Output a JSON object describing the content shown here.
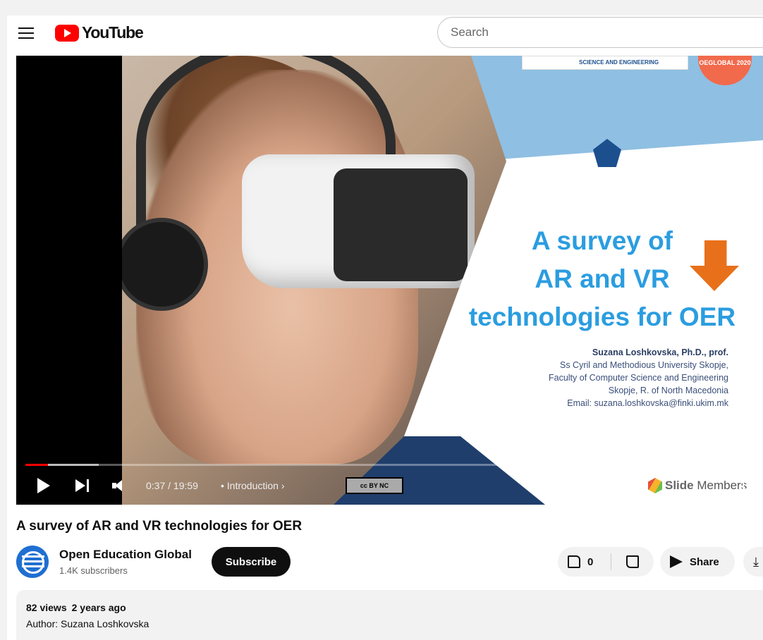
{
  "header": {
    "logo_text": "YouTube",
    "search_placeholder": "Search"
  },
  "player": {
    "time": "0:37 / 19:59",
    "chapter": "• Introduction ›",
    "progress_fraction": 0.031,
    "slide": {
      "title_lines": [
        "A survey of",
        "AR and VR",
        "technologies for OER"
      ],
      "logo_text": "SCIENCE AND ENGINEERING",
      "badge_text": "OEGLOBAL 2020",
      "author_name": "Suzana Loshkovska, Ph.D., prof.",
      "affiliation_1": "Ss Cyril and Methodious University Skopje,",
      "affiliation_2": "Faculty of Computer Science and Engineering",
      "affiliation_3": "Skopje, R. of North Macedonia",
      "email": "Email: suzana.loshkovska@finki.ukim.mk"
    },
    "cc_badge": "cc BY NC",
    "brand_bold": "Slide",
    "brand_rest": " Members"
  },
  "video": {
    "title": "A survey of AR and VR technologies for OER",
    "channel_name": "Open Education Global",
    "subscribers": "1.4K subscribers",
    "subscribe_label": "Subscribe",
    "likes": "0",
    "share_label": "Share"
  },
  "description": {
    "views": "82 views",
    "age": "2 years ago",
    "author_line": "Author: Suzana Loshkovska"
  },
  "icons": [
    "menu-icon",
    "youtube-logo",
    "play-icon",
    "next-icon",
    "volume-icon",
    "camera-icon",
    "like-icon",
    "dislike-icon",
    "share-icon",
    "download-icon"
  ],
  "colors": {
    "accent": "#ff0000",
    "slide_title": "#2b9de0",
    "arrow": "#e8701a"
  }
}
